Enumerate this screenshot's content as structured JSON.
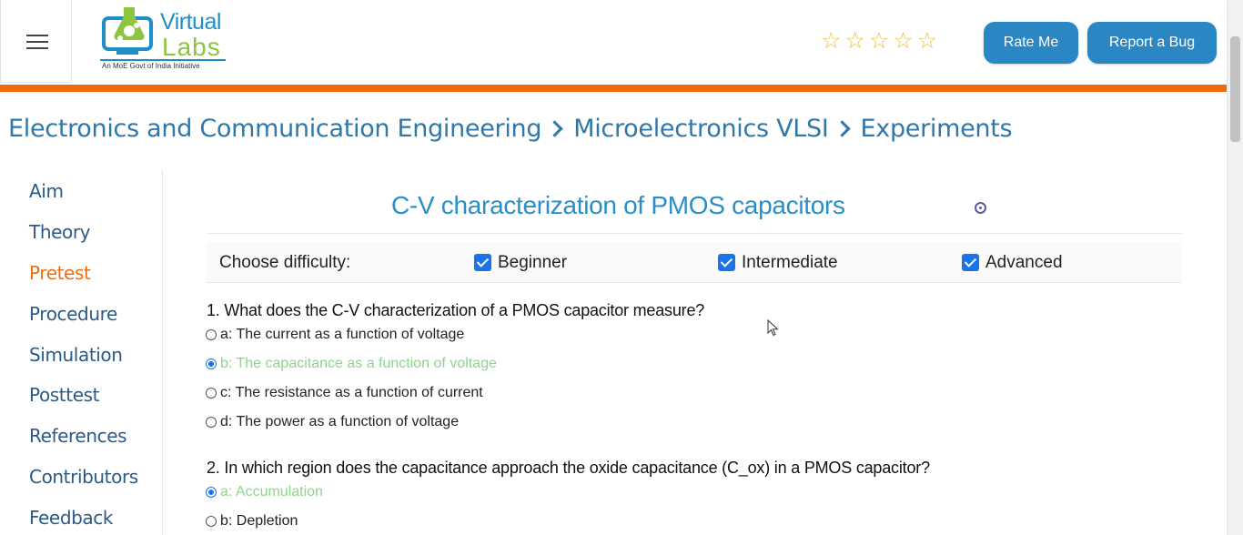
{
  "header": {
    "logo_title": "Virtual",
    "logo_subtitle": "Labs",
    "logo_tagline": "An MoE Govt of India Initiative",
    "rating_stars": 5,
    "rate_button": "Rate Me",
    "bug_button": "Report a Bug",
    "accent_color": "#ef6c0e",
    "button_color": "#2a87c4"
  },
  "breadcrumb": [
    "Electronics and Communication Engineering",
    "Microelectronics VLSI",
    "Experiments"
  ],
  "sidebar": {
    "items": [
      {
        "label": "Aim"
      },
      {
        "label": "Theory"
      },
      {
        "label": "Pretest",
        "active": true
      },
      {
        "label": "Procedure"
      },
      {
        "label": "Simulation"
      },
      {
        "label": "Posttest"
      },
      {
        "label": "References"
      },
      {
        "label": "Contributors"
      },
      {
        "label": "Feedback"
      }
    ]
  },
  "main": {
    "title": "C-V characterization of PMOS capacitors",
    "difficulty": {
      "label": "Choose difficulty:",
      "options": [
        {
          "label": "Beginner",
          "checked": true
        },
        {
          "label": "Intermediate",
          "checked": true
        },
        {
          "label": "Advanced",
          "checked": true
        }
      ]
    },
    "questions": [
      {
        "text": "1. What does the C-V characterization of a PMOS capacitor measure?",
        "options": [
          {
            "label": "a: The current as a function of voltage",
            "selected": false
          },
          {
            "label": "b: The capacitance as a function of voltage",
            "selected": true
          },
          {
            "label": "c: The resistance as a function of current",
            "selected": false
          },
          {
            "label": "d: The power as a function of voltage",
            "selected": false
          }
        ]
      },
      {
        "text": "2. In which region does the capacitance approach the oxide capacitance (C_ox) in a PMOS capacitor?",
        "options": [
          {
            "label": "a: Accumulation",
            "selected": true
          },
          {
            "label": "b: Depletion",
            "selected": false
          }
        ]
      }
    ]
  }
}
